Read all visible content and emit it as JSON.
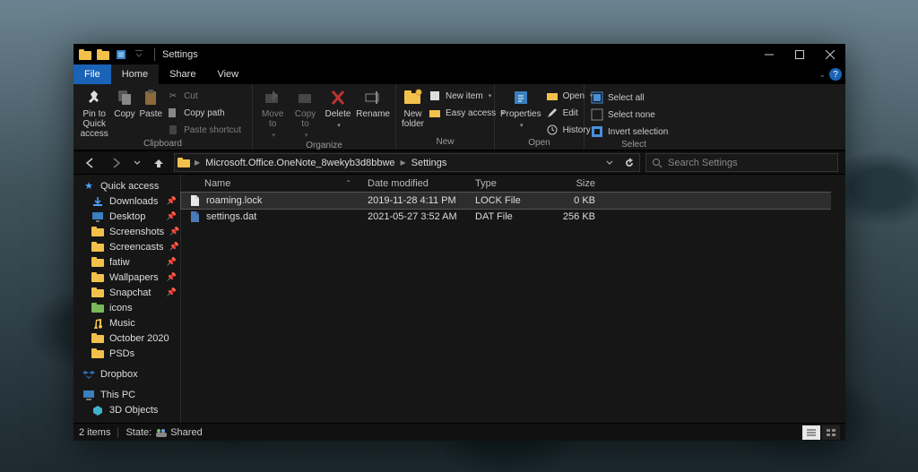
{
  "window": {
    "title": "Settings"
  },
  "tabs": {
    "file": "File",
    "home": "Home",
    "share": "Share",
    "view": "View"
  },
  "ribbon": {
    "clipboard": {
      "pin": "Pin to Quick\naccess",
      "copy": "Copy",
      "paste": "Paste",
      "cut": "Cut",
      "copypath": "Copy path",
      "pasteshortcut": "Paste shortcut",
      "group": "Clipboard"
    },
    "organize": {
      "moveto": "Move\nto",
      "copyto": "Copy\nto",
      "delete": "Delete",
      "rename": "Rename",
      "group": "Organize"
    },
    "new": {
      "newfolder": "New\nfolder",
      "newitem": "New item",
      "easyaccess": "Easy access",
      "group": "New"
    },
    "open": {
      "properties": "Properties",
      "open": "Open",
      "edit": "Edit",
      "history": "History",
      "group": "Open"
    },
    "select": {
      "selectall": "Select all",
      "selectnone": "Select none",
      "invert": "Invert selection",
      "group": "Select"
    }
  },
  "breadcrumb": {
    "parent": "Microsoft.Office.OneNote_8wekyb3d8bbwe",
    "current": "Settings"
  },
  "search": {
    "placeholder": "Search Settings"
  },
  "columns": {
    "name": "Name",
    "date": "Date modified",
    "type": "Type",
    "size": "Size"
  },
  "rows": [
    {
      "name": "roaming.lock",
      "date": "2019-11-28 4:11 PM",
      "type": "LOCK File",
      "size": "0 KB",
      "icon": "file",
      "selected": true
    },
    {
      "name": "settings.dat",
      "date": "2021-05-27 3:52 AM",
      "type": "DAT File",
      "size": "256 KB",
      "icon": "file",
      "selected": false
    }
  ],
  "sidebar": {
    "quickaccess": "Quick access",
    "items": [
      {
        "label": "Downloads",
        "icon": "downloads",
        "pinned": true
      },
      {
        "label": "Desktop",
        "icon": "desktop",
        "pinned": true
      },
      {
        "label": "Screenshots",
        "icon": "folder",
        "pinned": true
      },
      {
        "label": "Screencasts",
        "icon": "folder",
        "pinned": true
      },
      {
        "label": "fatiw",
        "icon": "folder",
        "pinned": true
      },
      {
        "label": "Wallpapers",
        "icon": "folder",
        "pinned": true
      },
      {
        "label": "Snapchat",
        "icon": "folder",
        "pinned": true
      },
      {
        "label": "icons",
        "icon": "folder-green",
        "pinned": false
      },
      {
        "label": "Music",
        "icon": "music",
        "pinned": false
      },
      {
        "label": "October 2020",
        "icon": "folder",
        "pinned": false
      },
      {
        "label": "PSDs",
        "icon": "folder",
        "pinned": false
      }
    ],
    "dropbox": "Dropbox",
    "thispc": "This PC",
    "threed": "3D Objects"
  },
  "status": {
    "items": "2 items",
    "state_label": "State:",
    "state_value": "Shared"
  }
}
